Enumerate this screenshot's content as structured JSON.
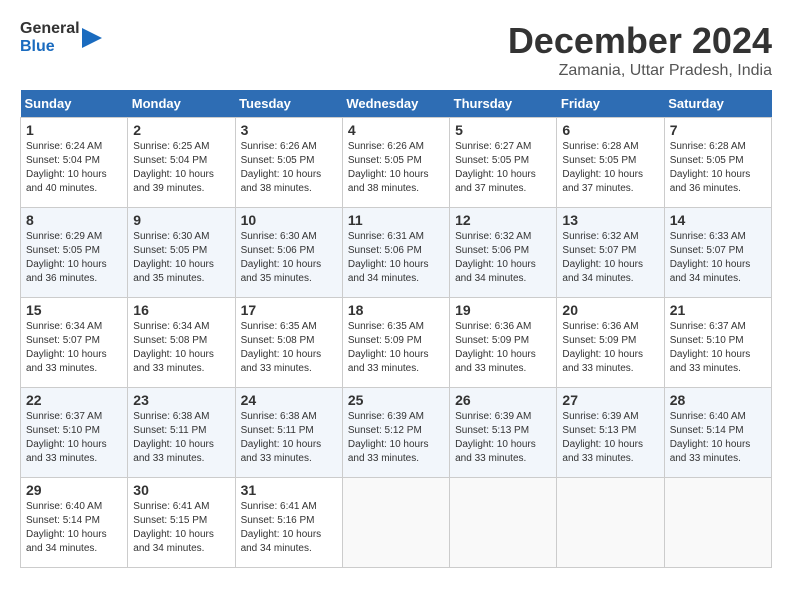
{
  "logo": {
    "line1": "General",
    "line2": "Blue"
  },
  "title": "December 2024",
  "subtitle": "Zamania, Uttar Pradesh, India",
  "weekdays": [
    "Sunday",
    "Monday",
    "Tuesday",
    "Wednesday",
    "Thursday",
    "Friday",
    "Saturday"
  ],
  "weeks": [
    [
      {
        "day": "1",
        "sunrise": "6:24 AM",
        "sunset": "5:04 PM",
        "daylight": "10 hours and 40 minutes."
      },
      {
        "day": "2",
        "sunrise": "6:25 AM",
        "sunset": "5:04 PM",
        "daylight": "10 hours and 39 minutes."
      },
      {
        "day": "3",
        "sunrise": "6:26 AM",
        "sunset": "5:05 PM",
        "daylight": "10 hours and 38 minutes."
      },
      {
        "day": "4",
        "sunrise": "6:26 AM",
        "sunset": "5:05 PM",
        "daylight": "10 hours and 38 minutes."
      },
      {
        "day": "5",
        "sunrise": "6:27 AM",
        "sunset": "5:05 PM",
        "daylight": "10 hours and 37 minutes."
      },
      {
        "day": "6",
        "sunrise": "6:28 AM",
        "sunset": "5:05 PM",
        "daylight": "10 hours and 37 minutes."
      },
      {
        "day": "7",
        "sunrise": "6:28 AM",
        "sunset": "5:05 PM",
        "daylight": "10 hours and 36 minutes."
      }
    ],
    [
      {
        "day": "8",
        "sunrise": "6:29 AM",
        "sunset": "5:05 PM",
        "daylight": "10 hours and 36 minutes."
      },
      {
        "day": "9",
        "sunrise": "6:30 AM",
        "sunset": "5:05 PM",
        "daylight": "10 hours and 35 minutes."
      },
      {
        "day": "10",
        "sunrise": "6:30 AM",
        "sunset": "5:06 PM",
        "daylight": "10 hours and 35 minutes."
      },
      {
        "day": "11",
        "sunrise": "6:31 AM",
        "sunset": "5:06 PM",
        "daylight": "10 hours and 34 minutes."
      },
      {
        "day": "12",
        "sunrise": "6:32 AM",
        "sunset": "5:06 PM",
        "daylight": "10 hours and 34 minutes."
      },
      {
        "day": "13",
        "sunrise": "6:32 AM",
        "sunset": "5:07 PM",
        "daylight": "10 hours and 34 minutes."
      },
      {
        "day": "14",
        "sunrise": "6:33 AM",
        "sunset": "5:07 PM",
        "daylight": "10 hours and 34 minutes."
      }
    ],
    [
      {
        "day": "15",
        "sunrise": "6:34 AM",
        "sunset": "5:07 PM",
        "daylight": "10 hours and 33 minutes."
      },
      {
        "day": "16",
        "sunrise": "6:34 AM",
        "sunset": "5:08 PM",
        "daylight": "10 hours and 33 minutes."
      },
      {
        "day": "17",
        "sunrise": "6:35 AM",
        "sunset": "5:08 PM",
        "daylight": "10 hours and 33 minutes."
      },
      {
        "day": "18",
        "sunrise": "6:35 AM",
        "sunset": "5:09 PM",
        "daylight": "10 hours and 33 minutes."
      },
      {
        "day": "19",
        "sunrise": "6:36 AM",
        "sunset": "5:09 PM",
        "daylight": "10 hours and 33 minutes."
      },
      {
        "day": "20",
        "sunrise": "6:36 AM",
        "sunset": "5:09 PM",
        "daylight": "10 hours and 33 minutes."
      },
      {
        "day": "21",
        "sunrise": "6:37 AM",
        "sunset": "5:10 PM",
        "daylight": "10 hours and 33 minutes."
      }
    ],
    [
      {
        "day": "22",
        "sunrise": "6:37 AM",
        "sunset": "5:10 PM",
        "daylight": "10 hours and 33 minutes."
      },
      {
        "day": "23",
        "sunrise": "6:38 AM",
        "sunset": "5:11 PM",
        "daylight": "10 hours and 33 minutes."
      },
      {
        "day": "24",
        "sunrise": "6:38 AM",
        "sunset": "5:11 PM",
        "daylight": "10 hours and 33 minutes."
      },
      {
        "day": "25",
        "sunrise": "6:39 AM",
        "sunset": "5:12 PM",
        "daylight": "10 hours and 33 minutes."
      },
      {
        "day": "26",
        "sunrise": "6:39 AM",
        "sunset": "5:13 PM",
        "daylight": "10 hours and 33 minutes."
      },
      {
        "day": "27",
        "sunrise": "6:39 AM",
        "sunset": "5:13 PM",
        "daylight": "10 hours and 33 minutes."
      },
      {
        "day": "28",
        "sunrise": "6:40 AM",
        "sunset": "5:14 PM",
        "daylight": "10 hours and 33 minutes."
      }
    ],
    [
      {
        "day": "29",
        "sunrise": "6:40 AM",
        "sunset": "5:14 PM",
        "daylight": "10 hours and 34 minutes."
      },
      {
        "day": "30",
        "sunrise": "6:41 AM",
        "sunset": "5:15 PM",
        "daylight": "10 hours and 34 minutes."
      },
      {
        "day": "31",
        "sunrise": "6:41 AM",
        "sunset": "5:16 PM",
        "daylight": "10 hours and 34 minutes."
      },
      null,
      null,
      null,
      null
    ]
  ],
  "labels": {
    "sunrise": "Sunrise: ",
    "sunset": "Sunset: ",
    "daylight": "Daylight: "
  }
}
